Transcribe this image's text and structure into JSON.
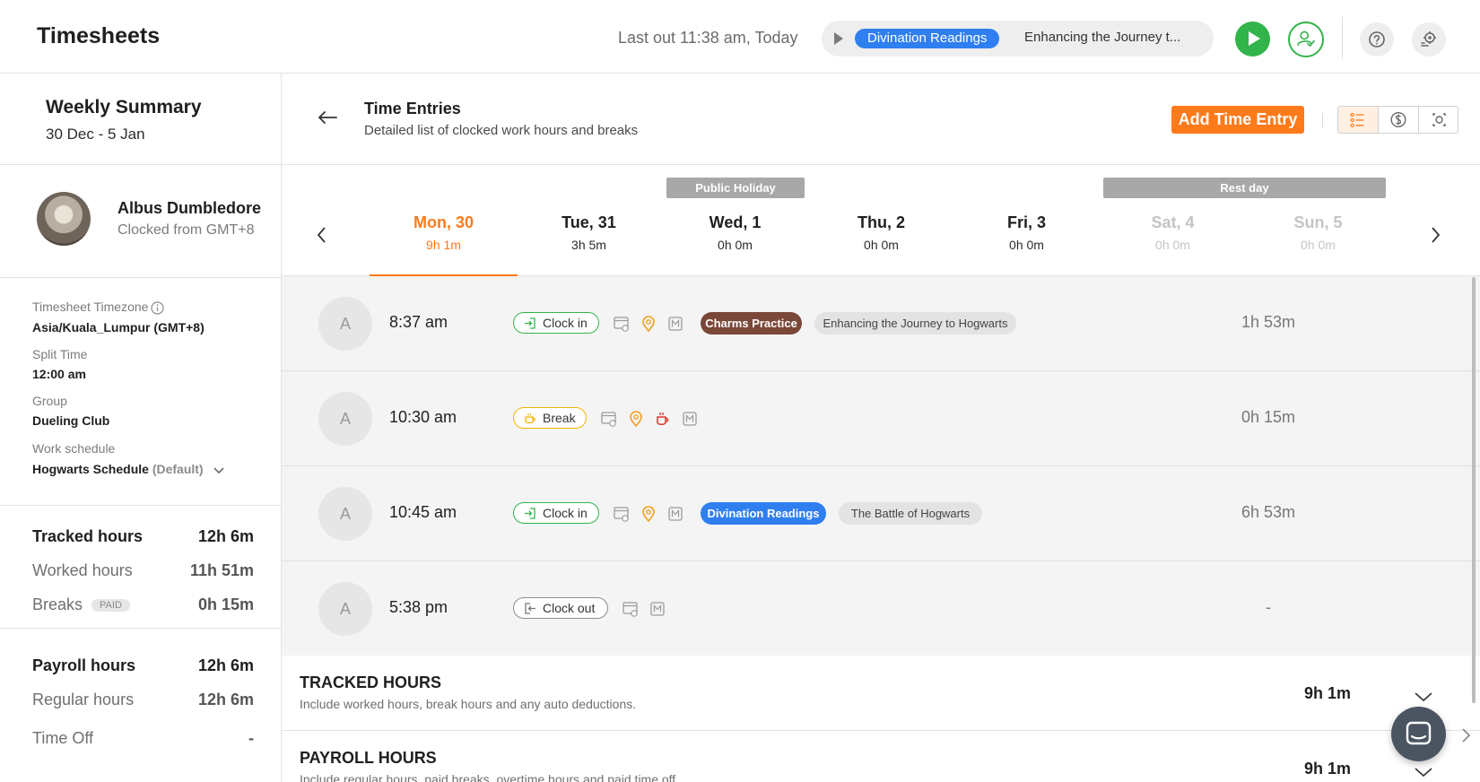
{
  "header": {
    "title": "Timesheets",
    "last_out": "Last out 11:38 am, Today",
    "timer": {
      "project": "Divination Readings",
      "project_color": "#2f7ff0",
      "task": "Enhancing the Journey to Hogwarts",
      "task_display": "Enhancing the Journey t..."
    },
    "icons": [
      "play-icon",
      "user-check-icon",
      "help-icon",
      "gear-icon"
    ]
  },
  "sidebar": {
    "weekly_summary": {
      "title": "Weekly Summary",
      "range": "30 Dec - 5 Jan"
    },
    "user": {
      "name": "Albus Dumbledore",
      "clocked_from": "Clocked from GMT+8"
    },
    "meta": [
      {
        "label": "Timesheet Timezone",
        "value": "Asia/Kuala_Lumpur (GMT+8)"
      },
      {
        "label": "Split Time",
        "value": "12:00 am"
      },
      {
        "label": "Group",
        "value": "Dueling Club"
      },
      {
        "label": "Work schedule",
        "value": "Hogwarts Schedule",
        "suffix": "(Default)"
      }
    ],
    "tracked": [
      {
        "label": "Tracked hours",
        "value": "12h 6m"
      },
      {
        "label": "Worked hours",
        "value": "11h 51m"
      },
      {
        "label": "Breaks",
        "badge": "PAID",
        "value": "0h 15m"
      }
    ],
    "payroll": [
      {
        "label": "Payroll hours",
        "value": "12h 6m"
      },
      {
        "label": "Regular hours",
        "value": "12h 6m"
      },
      {
        "label": "Time Off",
        "value": "-"
      }
    ]
  },
  "main": {
    "title": "Time Entries",
    "subtitle": "Detailed list of clocked work hours and breaks",
    "add_button": "Add Time Entry",
    "accent_color": "#ff7a1a",
    "view_modes": [
      "list-view-icon",
      "dollar-view-icon",
      "screenshot-view-icon"
    ],
    "tags": {
      "public_holiday": "Public Holiday",
      "rest_day": "Rest day"
    },
    "days": [
      {
        "name": "Mon, 30",
        "hours": "9h 1m",
        "state": "active"
      },
      {
        "name": "Tue, 31",
        "hours": "3h 5m",
        "state": "normal"
      },
      {
        "name": "Wed, 1",
        "hours": "0h 0m",
        "state": "holiday"
      },
      {
        "name": "Thu, 2",
        "hours": "0h 0m",
        "state": "normal"
      },
      {
        "name": "Fri, 3",
        "hours": "0h 0m",
        "state": "normal"
      },
      {
        "name": "Sat, 4",
        "hours": "0h 0m",
        "state": "rest"
      },
      {
        "name": "Sun, 5",
        "hours": "0h 0m",
        "state": "rest"
      }
    ],
    "entries": [
      {
        "avatar": "A",
        "time": "8:37 am",
        "type": "Clock in",
        "project": "Charms Practice",
        "project_color": "#7a4738",
        "task": "Enhancing the Journey to Hogwarts",
        "duration": "1h 53m"
      },
      {
        "avatar": "A",
        "time": "10:30 am",
        "type": "Break",
        "duration": "0h 15m"
      },
      {
        "avatar": "A",
        "time": "10:45 am",
        "type": "Clock in",
        "project": "Divination Readings",
        "project_color": "#2f7ff0",
        "task": "The Battle of Hogwarts",
        "duration": "6h 53m"
      },
      {
        "avatar": "A",
        "time": "5:38 pm",
        "type": "Clock out",
        "duration": "-"
      }
    ],
    "sections": [
      {
        "title": "TRACKED HOURS",
        "subtitle": "Include worked hours, break hours and any auto deductions.",
        "value": "9h 1m"
      },
      {
        "title": "PAYROLL HOURS",
        "subtitle": "Include regular hours, paid breaks, overtime hours and paid time off.",
        "value": "9h 1m"
      }
    ]
  }
}
